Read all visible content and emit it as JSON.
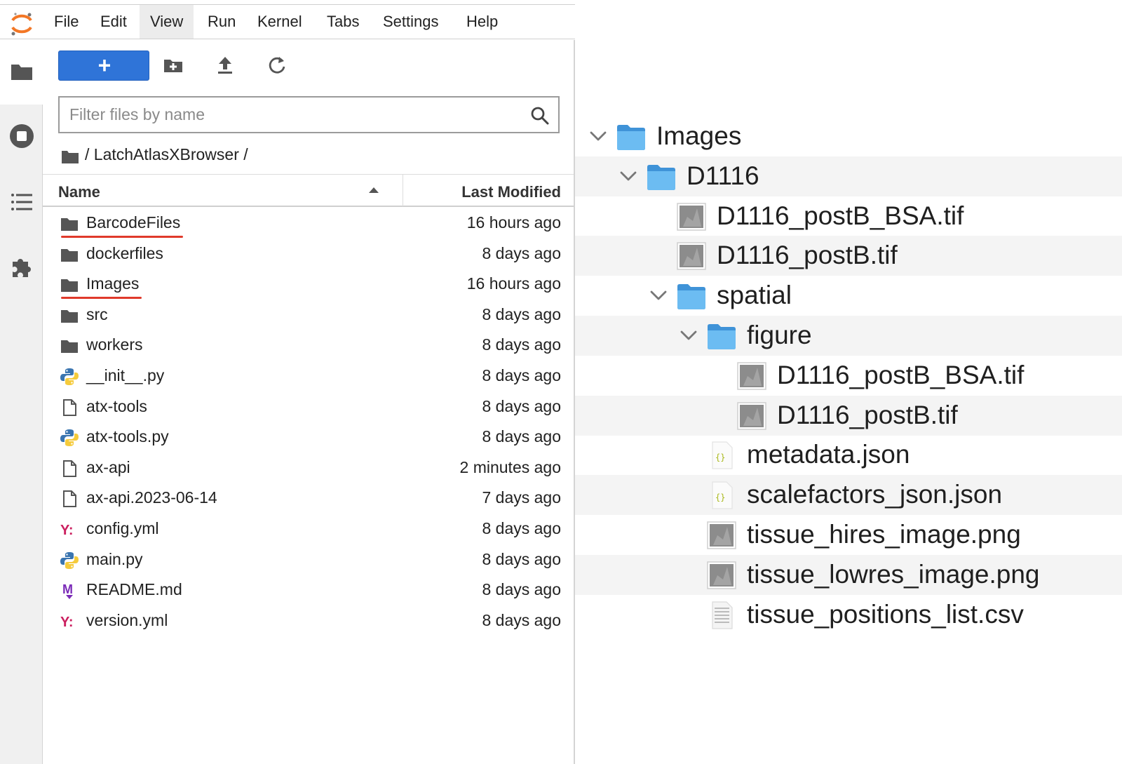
{
  "menubar": {
    "items": [
      "File",
      "Edit",
      "View",
      "Run",
      "Kernel",
      "Tabs",
      "Settings",
      "Help"
    ],
    "active": "View"
  },
  "left_sidebar": {
    "icons": [
      "folder-icon",
      "running-icon",
      "table-of-contents-icon",
      "extensions-icon"
    ],
    "selected": "folder-icon"
  },
  "toolbar": {
    "new_label": "+",
    "icons": [
      "new-folder-icon",
      "upload-icon",
      "refresh-icon"
    ]
  },
  "filter": {
    "placeholder": "Filter files by name",
    "value": ""
  },
  "breadcrumb": {
    "path": "/ LatchAtlasXBrowser /"
  },
  "columns": {
    "name": "Name",
    "modified": "Last Modified",
    "sort": "ascending"
  },
  "files": [
    {
      "name": "BarcodeFiles",
      "modified": "16 hours ago",
      "type": "folder",
      "underlined": true
    },
    {
      "name": "dockerfiles",
      "modified": "8 days ago",
      "type": "folder"
    },
    {
      "name": "Images",
      "modified": "16 hours ago",
      "type": "folder",
      "underlined": true
    },
    {
      "name": "src",
      "modified": "8 days ago",
      "type": "folder"
    },
    {
      "name": "workers",
      "modified": "8 days ago",
      "type": "folder"
    },
    {
      "name": "__init__.py",
      "modified": "8 days ago",
      "type": "python"
    },
    {
      "name": "atx-tools",
      "modified": "8 days ago",
      "type": "file"
    },
    {
      "name": "atx-tools.py",
      "modified": "8 days ago",
      "type": "python"
    },
    {
      "name": "ax-api",
      "modified": "2 minutes ago",
      "type": "file"
    },
    {
      "name": "ax-api.2023-06-14",
      "modified": "7 days ago",
      "type": "file"
    },
    {
      "name": "config.yml",
      "modified": "8 days ago",
      "type": "yaml"
    },
    {
      "name": "main.py",
      "modified": "8 days ago",
      "type": "python"
    },
    {
      "name": "README.md",
      "modified": "8 days ago",
      "type": "markdown"
    },
    {
      "name": "version.yml",
      "modified": "8 days ago",
      "type": "yaml"
    }
  ],
  "tree": [
    {
      "name": "Images",
      "type": "folder",
      "expanded": true
    },
    {
      "name": "D1116",
      "type": "folder",
      "expanded": true
    },
    {
      "name": "D1116_postB_BSA.tif",
      "type": "image"
    },
    {
      "name": "D1116_postB.tif",
      "type": "image"
    },
    {
      "name": "spatial",
      "type": "folder",
      "expanded": true
    },
    {
      "name": "figure",
      "type": "folder",
      "expanded": true
    },
    {
      "name": "D1116_postB_BSA.tif",
      "type": "image"
    },
    {
      "name": "D1116_postB.tif",
      "type": "image"
    },
    {
      "name": "metadata.json",
      "type": "json"
    },
    {
      "name": "scalefactors_json.json",
      "type": "json"
    },
    {
      "name": "tissue_hires_image.png",
      "type": "image"
    },
    {
      "name": "tissue_lowres_image.png",
      "type": "image"
    },
    {
      "name": "tissue_positions_list.csv",
      "type": "csv"
    }
  ],
  "colors": {
    "accent": "#2f74d8",
    "underline": "#e03a2b",
    "finder_folder": "#5eb1ee",
    "yaml": "#cb1f5f",
    "markdown": "#7b2bb8"
  }
}
